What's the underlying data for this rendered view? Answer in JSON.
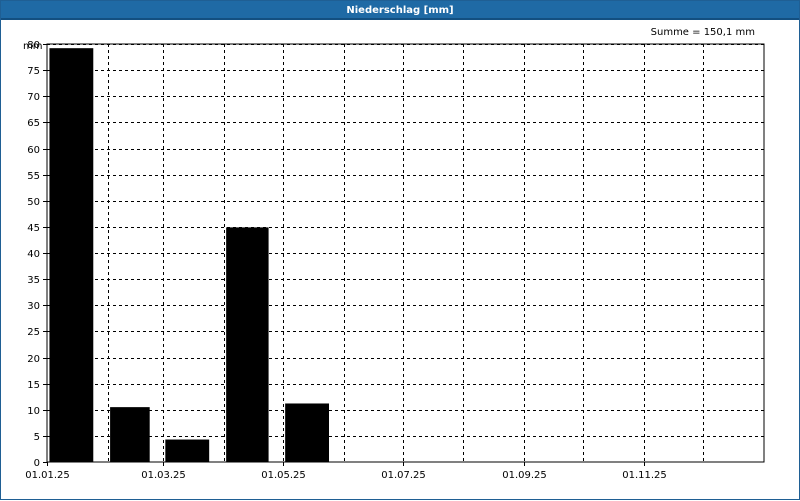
{
  "window": {
    "title": "Niederschlag [mm]"
  },
  "chart_data": {
    "type": "bar",
    "title": "Niederschlag [mm]",
    "sum_label": "Summe = 150,1 mm",
    "ylabel": "mm",
    "xlabel": "",
    "ylim": [
      0,
      80
    ],
    "ytick_step": 5,
    "x_axis": {
      "start": "2025-01-01",
      "end": "2026-01-01"
    },
    "x_tick_labels": [
      {
        "date": "2025-01-01",
        "label": "01.01.25"
      },
      {
        "date": "2025-03-01",
        "label": "01.03.25"
      },
      {
        "date": "2025-05-01",
        "label": "01.05.25"
      },
      {
        "date": "2025-07-01",
        "label": "01.07.25"
      },
      {
        "date": "2025-09-01",
        "label": "01.09.25"
      },
      {
        "date": "2025-11-01",
        "label": "01.11.25"
      }
    ],
    "x_gridlines": [
      "2025-02-01",
      "2025-03-01",
      "2025-04-01",
      "2025-05-01",
      "2025-06-01",
      "2025-07-01",
      "2025-08-01",
      "2025-09-01",
      "2025-10-01",
      "2025-11-01",
      "2025-12-01"
    ],
    "bars": [
      {
        "start": "2025-01-01",
        "end": "2025-02-01",
        "value": 79.2
      },
      {
        "start": "2025-02-01",
        "end": "2025-03-01",
        "value": 10.5
      },
      {
        "start": "2025-03-01",
        "end": "2025-04-01",
        "value": 4.3
      },
      {
        "start": "2025-04-01",
        "end": "2025-05-01",
        "value": 44.9
      },
      {
        "start": "2025-05-01",
        "end": "2025-06-01",
        "value": 11.2
      }
    ],
    "grid": true,
    "colors": {
      "bar": "#000000",
      "grid": "#000000",
      "title_bar": "#1f6aa5"
    }
  }
}
